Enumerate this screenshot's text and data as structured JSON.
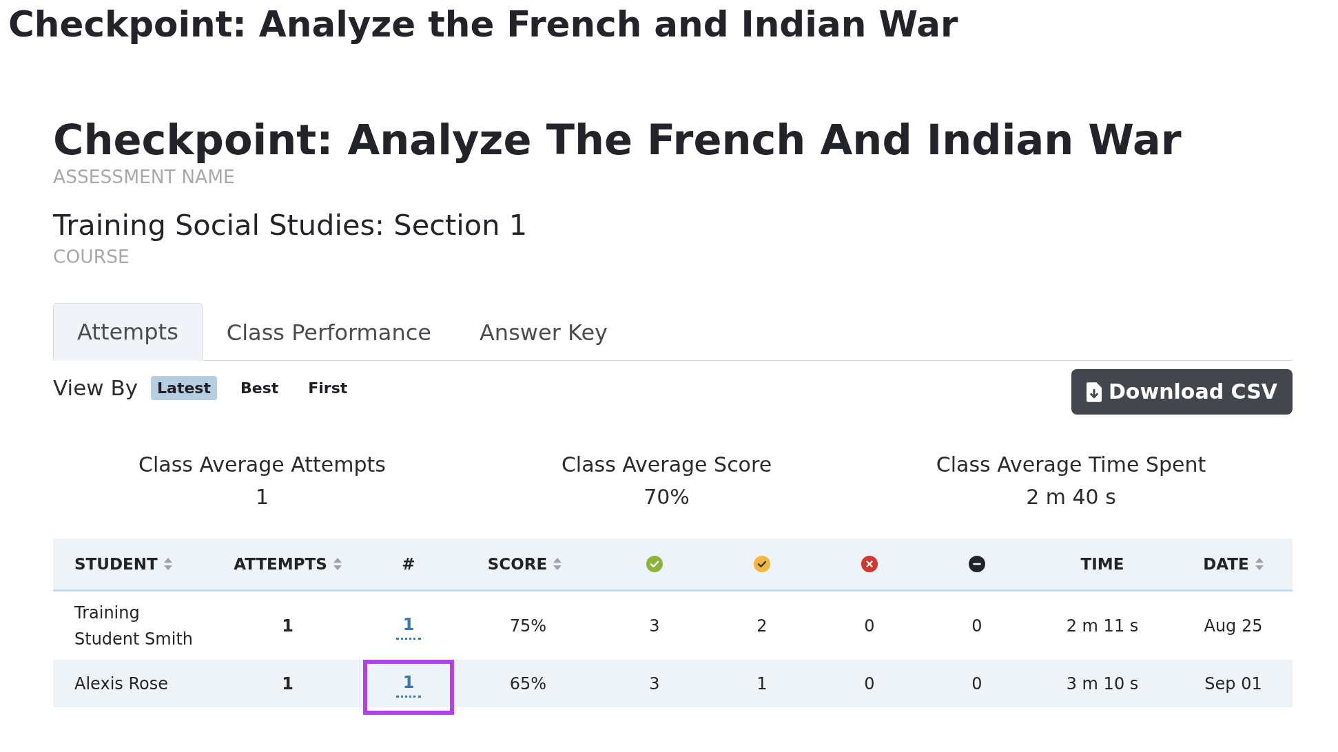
{
  "page_title": "Checkpoint: Analyze the French and Indian War",
  "assessment": {
    "name": "Checkpoint: Analyze The French And Indian War",
    "name_label": "ASSESSMENT NAME",
    "course": "Training Social Studies: Section 1",
    "course_label": "COURSE"
  },
  "tabs": [
    {
      "label": "Attempts",
      "selected": true
    },
    {
      "label": "Class Performance",
      "selected": false
    },
    {
      "label": "Answer Key",
      "selected": false
    }
  ],
  "view_by": {
    "label": "View By",
    "options": [
      {
        "label": "Latest",
        "selected": true
      },
      {
        "label": "Best",
        "selected": false
      },
      {
        "label": "First",
        "selected": false
      }
    ]
  },
  "download_button": "Download CSV",
  "class_averages": [
    {
      "label": "Class Average Attempts",
      "value": "1"
    },
    {
      "label": "Class Average Score",
      "value": "70%"
    },
    {
      "label": "Class Average Time Spent",
      "value": "2 m 40 s"
    }
  ],
  "table": {
    "columns": [
      {
        "kind": "label",
        "label": "STUDENT",
        "sortable": true
      },
      {
        "kind": "label",
        "label": "ATTEMPTS",
        "sortable": true
      },
      {
        "kind": "label",
        "label": "#",
        "sortable": false
      },
      {
        "kind": "label",
        "label": "SCORE",
        "sortable": true
      },
      {
        "kind": "check",
        "color": "#8cb33c",
        "sortable": false
      },
      {
        "kind": "check",
        "color": "#f3b63f",
        "sortable": false
      },
      {
        "kind": "cross",
        "color": "#d2372e",
        "sortable": false
      },
      {
        "kind": "minus",
        "color": "#212429",
        "sortable": false
      },
      {
        "kind": "label",
        "label": "TIME",
        "sortable": false
      },
      {
        "kind": "label",
        "label": "DATE",
        "sortable": true
      }
    ],
    "rows": [
      {
        "student": "Training Student Smith",
        "attempts": "1",
        "attempt_number": "1",
        "highlighted": false,
        "score": "75%",
        "counts": [
          "3",
          "2",
          "0",
          "0"
        ],
        "time": "2 m 11 s",
        "date": "Aug 25"
      },
      {
        "student": "Alexis Rose",
        "attempts": "1",
        "attempt_number": "1",
        "highlighted": true,
        "score": "65%",
        "counts": [
          "3",
          "1",
          "0",
          "0"
        ],
        "time": "3 m 10 s",
        "date": "Sep 01"
      }
    ]
  }
}
